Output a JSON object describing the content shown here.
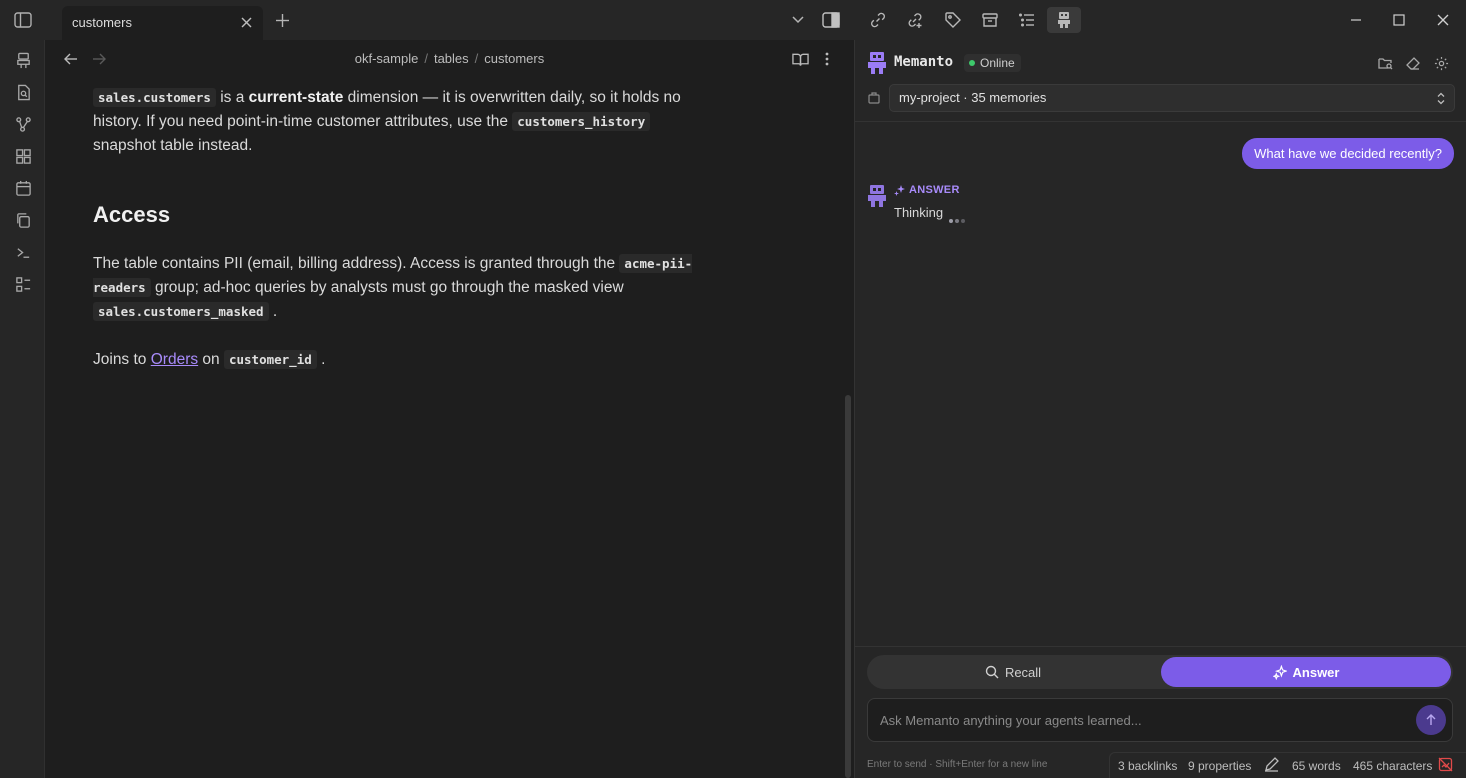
{
  "tab": {
    "title": "customers"
  },
  "breadcrumb": {
    "parts": [
      "okf-sample",
      "tables",
      "customers"
    ]
  },
  "document": {
    "p1": {
      "code1": "sales.customers",
      "t1": " is a ",
      "bold": "current-state",
      "t2": " dimension — it is overwritten daily, so it holds no history. If you need point-in-time customer attributes, use the ",
      "code2": "customers_history",
      "t3": " snapshot table instead."
    },
    "heading": "Access",
    "p2": {
      "t1": "The table contains PII (email, billing address). Access is granted through the ",
      "code1": "acme-pii-readers",
      "t2": " group; ad-hoc queries by analysts must go through the masked view ",
      "code2": "sales.customers_masked",
      "t3": " ."
    },
    "p3": {
      "t1": "Joins to ",
      "link": "Orders",
      "t2": " on ",
      "code": "customer_id",
      "t3": " ."
    }
  },
  "panel": {
    "title": "Memanto",
    "status": "Online",
    "status_color": "#3ec96b",
    "project_select": "my-project · 35 memories",
    "user_message": "What have we decided recently?",
    "answer_label": "ANSWER",
    "answer_text": "Thinking",
    "mode": {
      "recall": "Recall",
      "answer": "Answer",
      "active": "answer"
    },
    "input_placeholder": "Ask Memanto anything your agents learned...",
    "hint": "Enter to send · Shift+Enter for a new line",
    "accent_color": "#7c5ce8"
  },
  "statusbar": {
    "backlinks": "3 backlinks",
    "properties": "9 properties",
    "words": "65 words",
    "characters": "465 characters"
  }
}
